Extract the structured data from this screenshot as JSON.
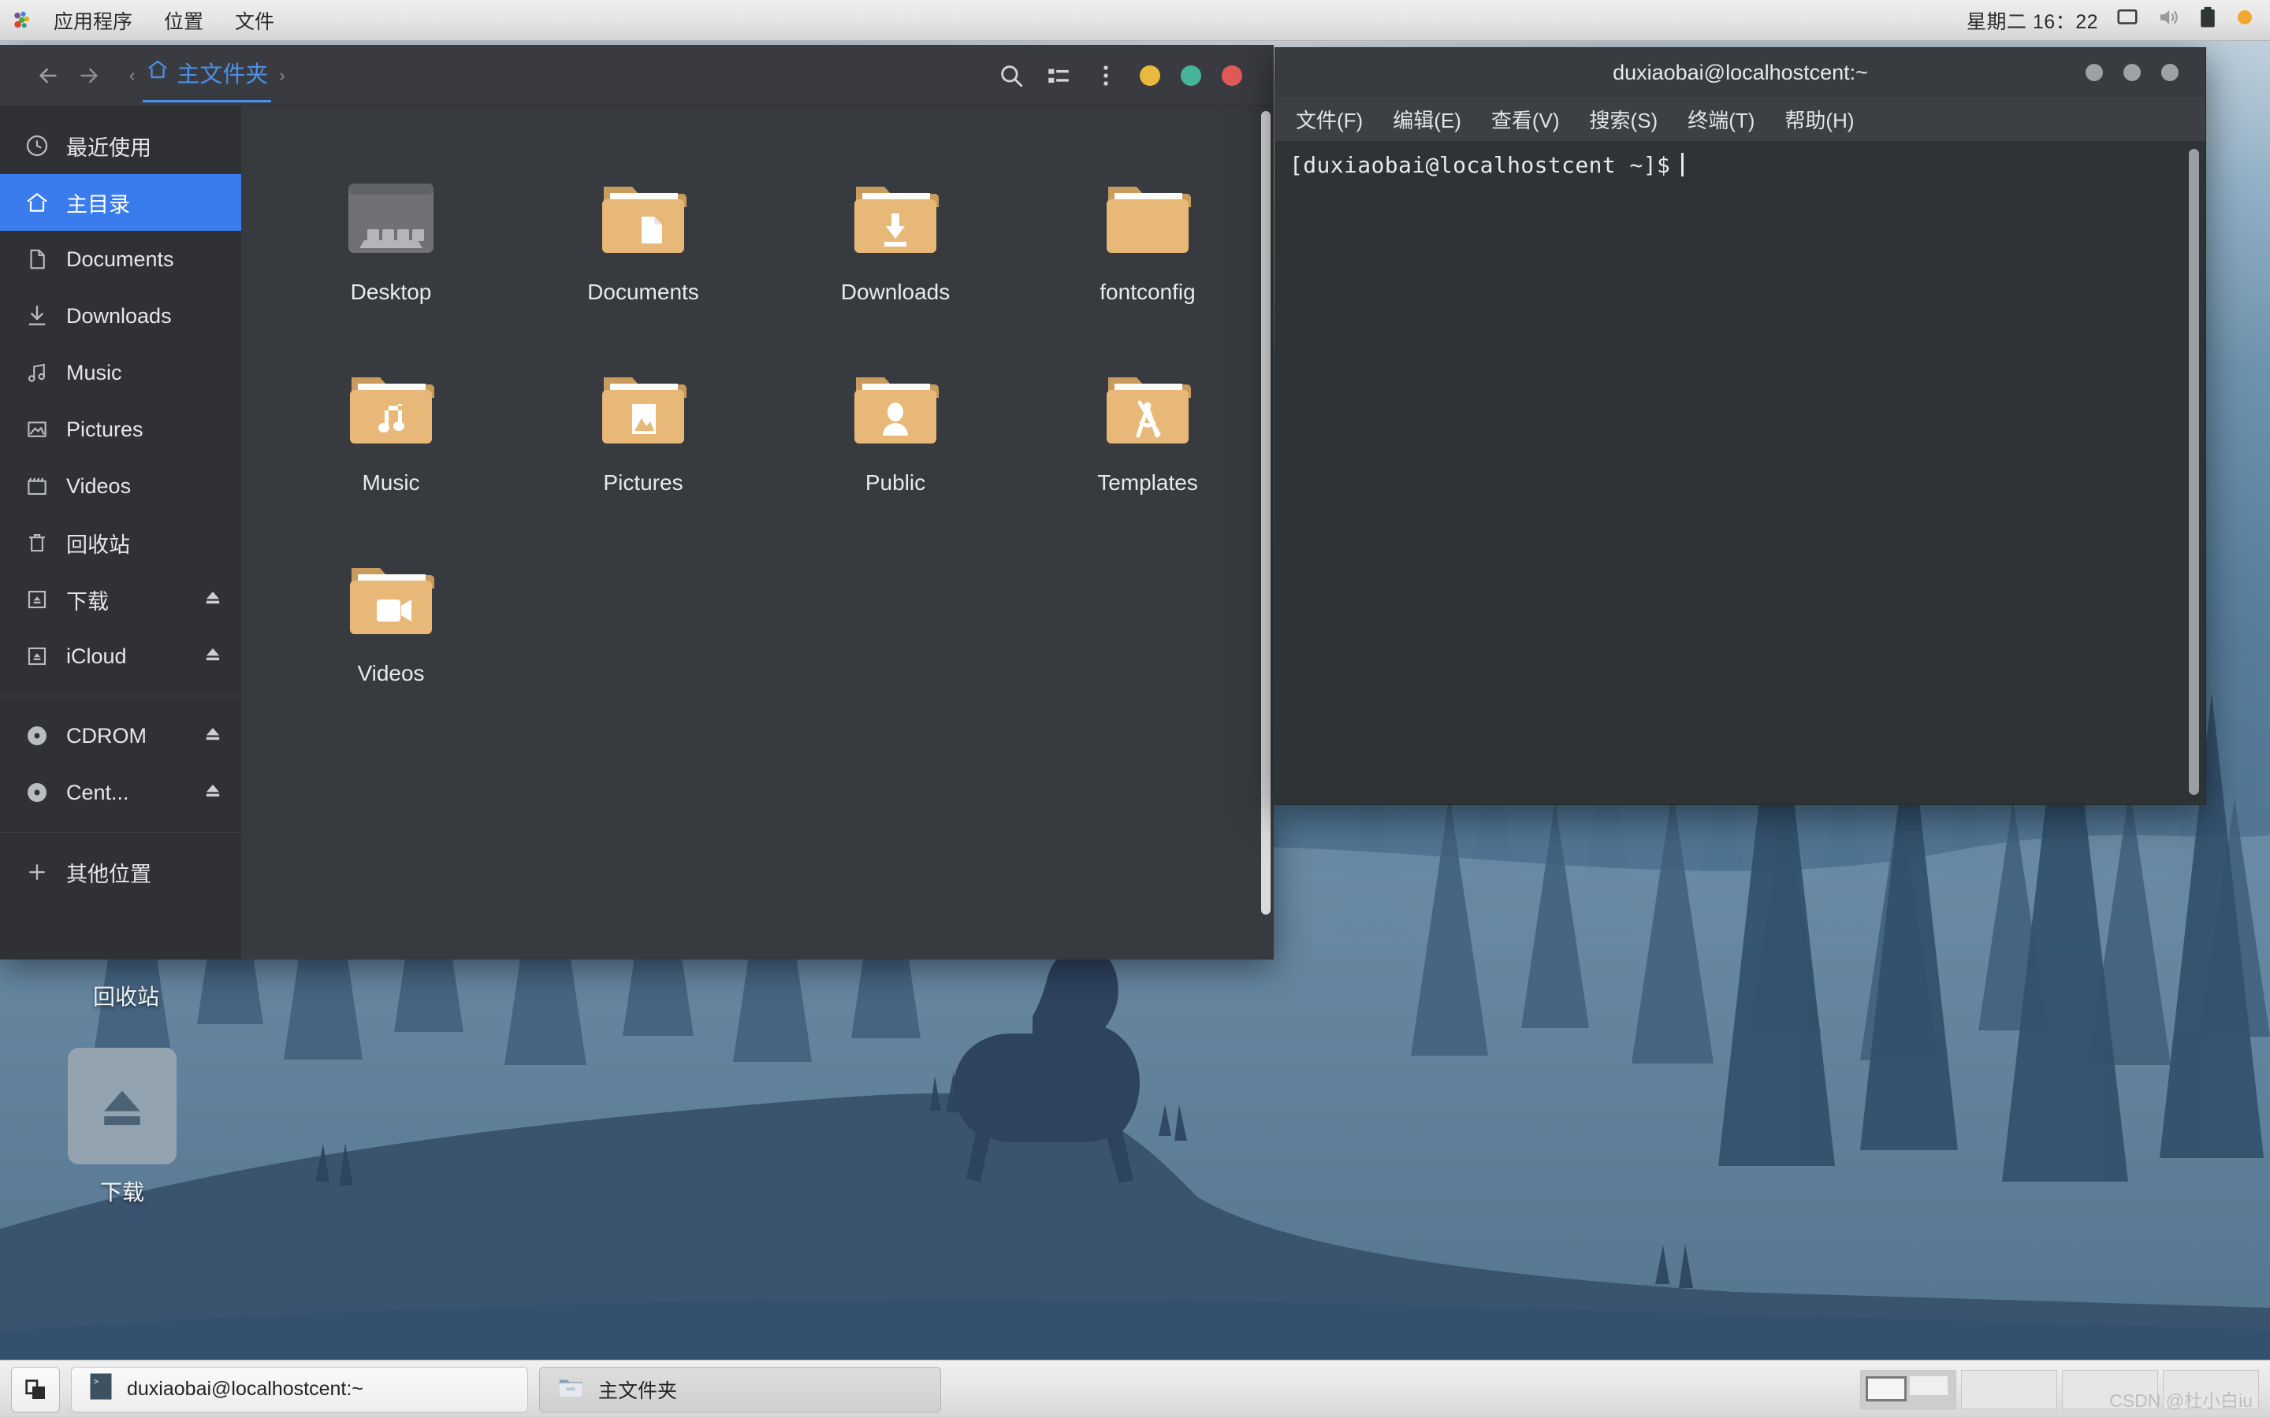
{
  "top_panel": {
    "logo_icon": "gnome-foot-icon",
    "menus": [
      "应用程序",
      "位置",
      "文件"
    ],
    "clock": "星期二 16：22",
    "tray": [
      {
        "icon": "display-icon",
        "name": "display-icon"
      },
      {
        "icon": "volume-icon",
        "name": "volume-icon"
      },
      {
        "icon": "battery-icon",
        "name": "battery-icon"
      },
      {
        "icon": "status-dot-icon",
        "name": "status-dot-icon",
        "color": "#f0a830"
      }
    ]
  },
  "file_manager": {
    "title": "主文件夹",
    "nav": {
      "back_icon": "arrow-left-icon",
      "forward_icon": "arrow-right-icon"
    },
    "breadcrumb": {
      "prev_arrow": "‹",
      "home_icon": "home-icon",
      "label": "主文件夹",
      "next_arrow": "›"
    },
    "header_actions": [
      {
        "name": "search-icon",
        "label": "搜索"
      },
      {
        "name": "view-list-icon",
        "label": "列表视图"
      },
      {
        "name": "menu-kebab-icon",
        "label": "菜单"
      }
    ],
    "window_buttons": [
      {
        "name": "minimize-button",
        "color": "#e8b93c"
      },
      {
        "name": "maximize-button",
        "color": "#45b49a"
      },
      {
        "name": "close-button",
        "color": "#e05a5a"
      }
    ],
    "sidebar": [
      {
        "label": "最近使用",
        "icon": "clock-icon",
        "selected": false,
        "eject": false
      },
      {
        "label": "主目录",
        "icon": "home-icon",
        "selected": true,
        "eject": false
      },
      {
        "label": "Documents",
        "icon": "document-icon",
        "selected": false,
        "eject": false
      },
      {
        "label": "Downloads",
        "icon": "download-icon",
        "selected": false,
        "eject": false
      },
      {
        "label": "Music",
        "icon": "music-icon",
        "selected": false,
        "eject": false
      },
      {
        "label": "Pictures",
        "icon": "image-icon",
        "selected": false,
        "eject": false
      },
      {
        "label": "Videos",
        "icon": "video-icon",
        "selected": false,
        "eject": false
      },
      {
        "label": "回收站",
        "icon": "trash-icon",
        "selected": false,
        "eject": false
      },
      {
        "label": "下载",
        "icon": "drive-icon",
        "selected": false,
        "eject": true
      },
      {
        "label": "iCloud",
        "icon": "drive-icon",
        "selected": false,
        "eject": true
      },
      {
        "label": "CDROM",
        "icon": "disc-icon",
        "selected": false,
        "eject": true
      },
      {
        "label": "Cent...",
        "icon": "disc-icon",
        "selected": false,
        "eject": true
      },
      {
        "label": "其他位置",
        "icon": "plus-icon",
        "selected": false,
        "eject": false
      }
    ],
    "files": [
      {
        "label": "Desktop",
        "icon": "desktop-folder-icon"
      },
      {
        "label": "Documents",
        "icon": "documents-folder-icon"
      },
      {
        "label": "Downloads",
        "icon": "downloads-folder-icon"
      },
      {
        "label": "fontconfig",
        "icon": "plain-folder-icon"
      },
      {
        "label": "Music",
        "icon": "music-folder-icon"
      },
      {
        "label": "Pictures",
        "icon": "pictures-folder-icon"
      },
      {
        "label": "Public",
        "icon": "public-folder-icon"
      },
      {
        "label": "Templates",
        "icon": "templates-folder-icon"
      },
      {
        "label": "Videos",
        "icon": "videos-folder-icon"
      }
    ],
    "folder_color": "#e8b878"
  },
  "terminal": {
    "title": "duxiaobai@localhostcent:~",
    "menus": [
      "文件(F)",
      "编辑(E)",
      "查看(V)",
      "搜索(S)",
      "终端(T)",
      "帮助(H)"
    ],
    "prompt": "[duxiaobai@localhostcent ~]$",
    "window_buttons": [
      {
        "name": "minimize-button"
      },
      {
        "name": "maximize-button"
      },
      {
        "name": "close-button"
      }
    ]
  },
  "desktop_icons": [
    {
      "label": "回收站",
      "icon": "trash-icon"
    },
    {
      "label": "下载",
      "icon": "eject-drive-icon"
    }
  ],
  "taskbar": {
    "show_desktop_icon": "show-desktop-icon",
    "windows": [
      {
        "label": "duxiaobai@localhostcent:~",
        "icon": "terminal-icon",
        "active": false
      },
      {
        "label": "主文件夹",
        "icon": "folder-icon",
        "active": true
      }
    ],
    "workspaces": [
      {
        "index": 1,
        "active": true
      },
      {
        "index": 2,
        "active": false
      },
      {
        "index": 3,
        "active": false
      },
      {
        "index": 4,
        "active": false
      }
    ],
    "watermark": "CSDN @杜小白iu"
  }
}
